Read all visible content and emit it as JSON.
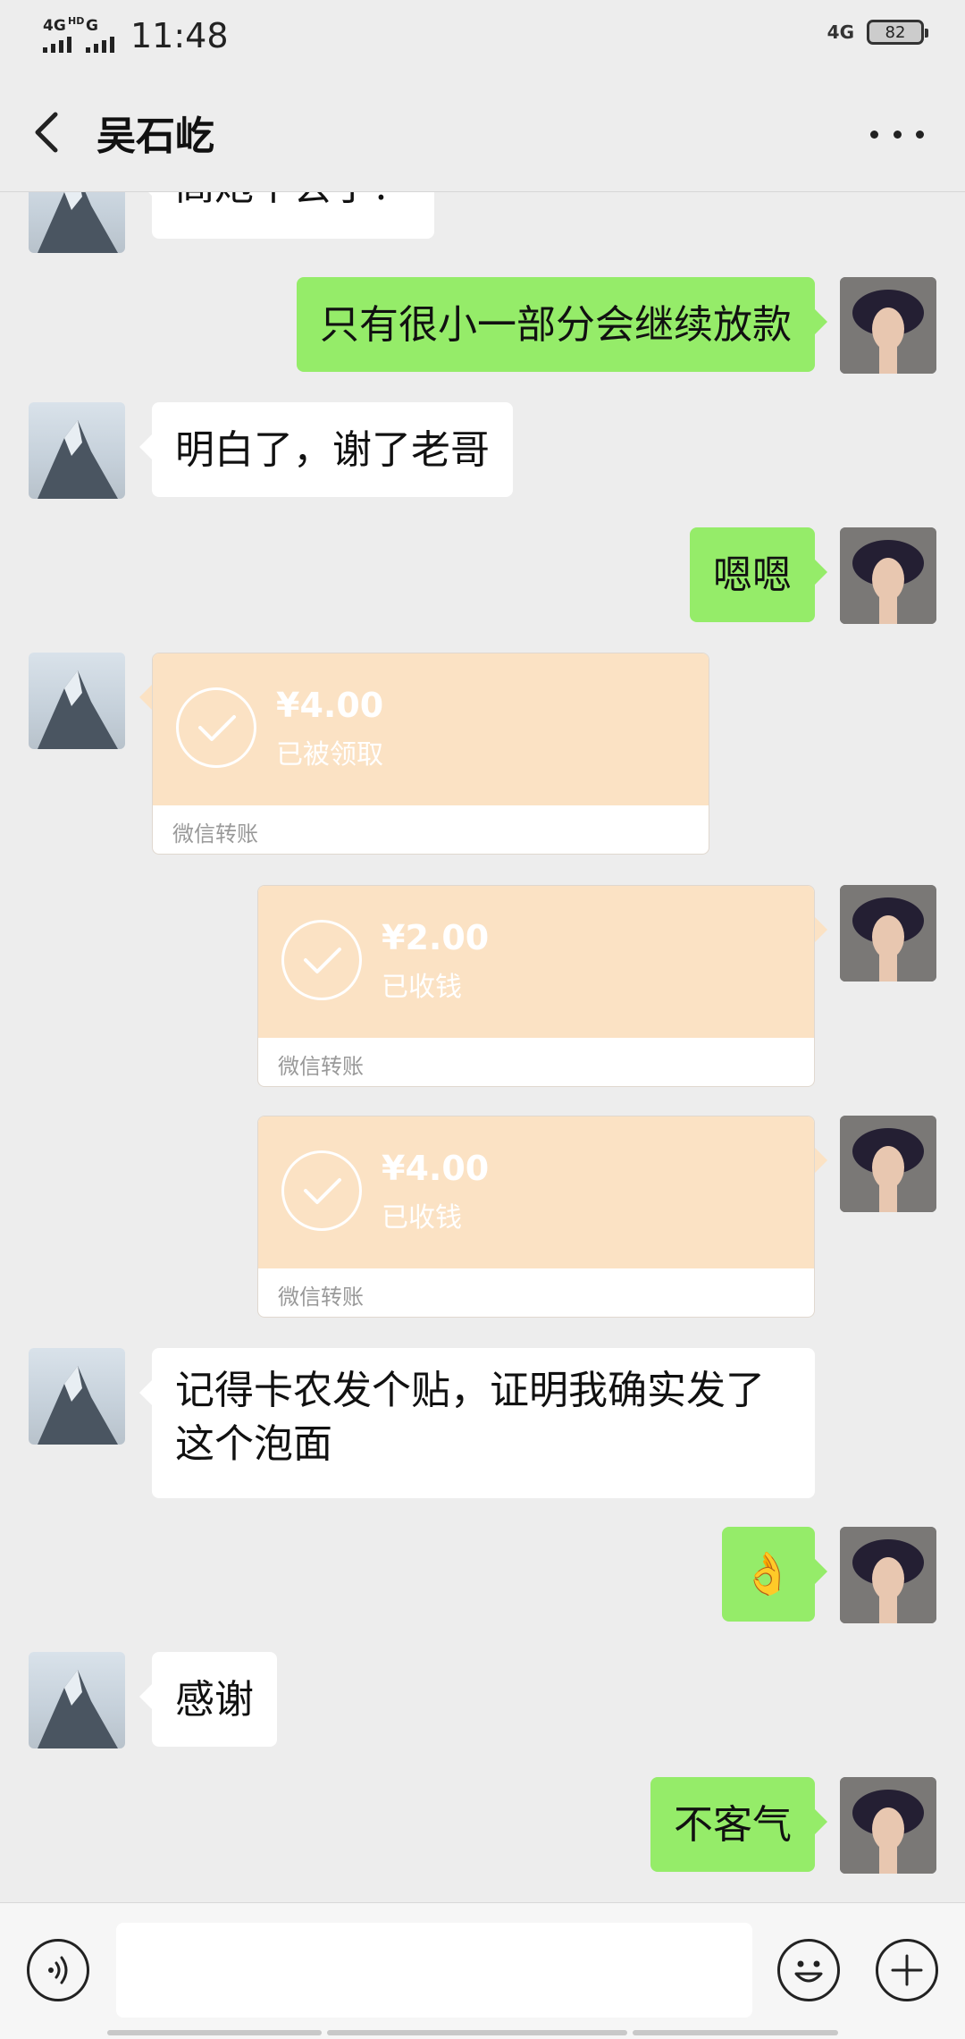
{
  "status_bar": {
    "network_1": "4G",
    "network_1_sup": "HD",
    "network_2": "G",
    "time": "11:48",
    "network_right": "4G",
    "battery": "82"
  },
  "header": {
    "title": "吴石屹"
  },
  "icons": {
    "back": "chevron-left-icon",
    "more": "more-dots-icon",
    "voice": "voice-icon",
    "emoji": "emoji-icon",
    "plus": "plus-icon",
    "check": "check-icon"
  },
  "colors": {
    "background": "#ededed",
    "outgoing_bubble": "#95ec69",
    "incoming_bubble": "#ffffff",
    "transfer_bubble": "#fbe2c4"
  },
  "messages": [
    {
      "side": "in",
      "type": "text",
      "text": "高炮不会了？"
    },
    {
      "side": "out",
      "type": "text",
      "text": "只有很小一部分会继续放款"
    },
    {
      "side": "in",
      "type": "text",
      "text": "明白了，谢了老哥"
    },
    {
      "side": "out",
      "type": "text",
      "text": "嗯嗯"
    },
    {
      "side": "in",
      "type": "transfer",
      "amount": "¥4.00",
      "status": "已被领取",
      "footer": "微信转账"
    },
    {
      "side": "out",
      "type": "transfer",
      "amount": "¥2.00",
      "status": "已收钱",
      "footer": "微信转账"
    },
    {
      "side": "out",
      "type": "transfer",
      "amount": "¥4.00",
      "status": "已收钱",
      "footer": "微信转账"
    },
    {
      "side": "in",
      "type": "text",
      "text": "记得卡农发个贴，证明我确实发了这个泡面"
    },
    {
      "side": "out",
      "type": "emoji",
      "emoji": "👌"
    },
    {
      "side": "in",
      "type": "text",
      "text": "感谢"
    },
    {
      "side": "out",
      "type": "text",
      "text": "不客气"
    }
  ]
}
